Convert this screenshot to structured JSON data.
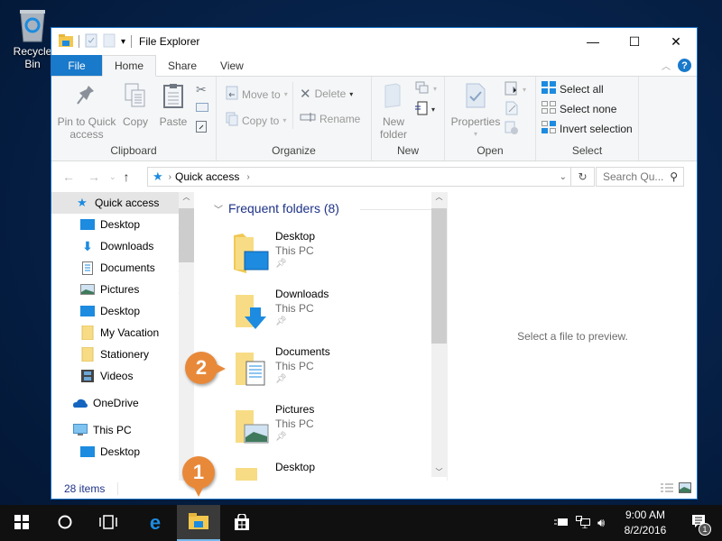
{
  "desktop": {
    "recycle_bin_label": "Recycle Bin"
  },
  "window": {
    "title": "File Explorer",
    "controls": {
      "minimize": "—",
      "maximize": "☐",
      "close": "✕"
    }
  },
  "ribbon_tabs": [
    {
      "label": "File"
    },
    {
      "label": "Home"
    },
    {
      "label": "Share"
    },
    {
      "label": "View"
    }
  ],
  "help_label": "?",
  "ribbon": {
    "clipboard": {
      "label": "Clipboard",
      "pin_label_1": "Pin to Quick",
      "pin_label_2": "access",
      "copy": "Copy",
      "paste": "Paste"
    },
    "organize": {
      "label": "Organize",
      "move_to": "Move to",
      "copy_to": "Copy to",
      "delete": "Delete",
      "rename": "Rename"
    },
    "new": {
      "label": "New",
      "new_folder_1": "New",
      "new_folder_2": "folder"
    },
    "open": {
      "label": "Open",
      "properties": "Properties"
    },
    "select": {
      "label": "Select",
      "select_all": "Select all",
      "select_none": "Select none",
      "invert_selection": "Invert selection"
    }
  },
  "address": {
    "crumb": "Quick access",
    "search_placeholder": "Search Qu..."
  },
  "nav": {
    "quick_access": "Quick access",
    "items": [
      {
        "label": "Desktop",
        "pinned": true
      },
      {
        "label": "Downloads",
        "pinned": true
      },
      {
        "label": "Documents",
        "pinned": true
      },
      {
        "label": "Pictures",
        "pinned": true
      },
      {
        "label": "Desktop",
        "pinned": false
      },
      {
        "label": "My Vacation",
        "pinned": false
      },
      {
        "label": "Stationery",
        "pinned": false
      },
      {
        "label": "Videos",
        "pinned": false
      }
    ],
    "onedrive": "OneDrive",
    "this_pc": "This PC",
    "this_pc_desktop": "Desktop"
  },
  "content": {
    "section_title": "Frequent folders (8)",
    "folders": [
      {
        "name": "Desktop",
        "location": "This PC"
      },
      {
        "name": "Downloads",
        "location": "This PC"
      },
      {
        "name": "Documents",
        "location": "This PC"
      },
      {
        "name": "Pictures",
        "location": "This PC"
      },
      {
        "name": "Desktop",
        "location": ""
      }
    ]
  },
  "preview_text": "Select a file to preview.",
  "status": {
    "item_count": "28 items"
  },
  "taskbar": {
    "time": "9:00 AM",
    "date": "8/2/2016",
    "notification_count": "1"
  },
  "callouts": {
    "one": "1",
    "two": "2"
  }
}
